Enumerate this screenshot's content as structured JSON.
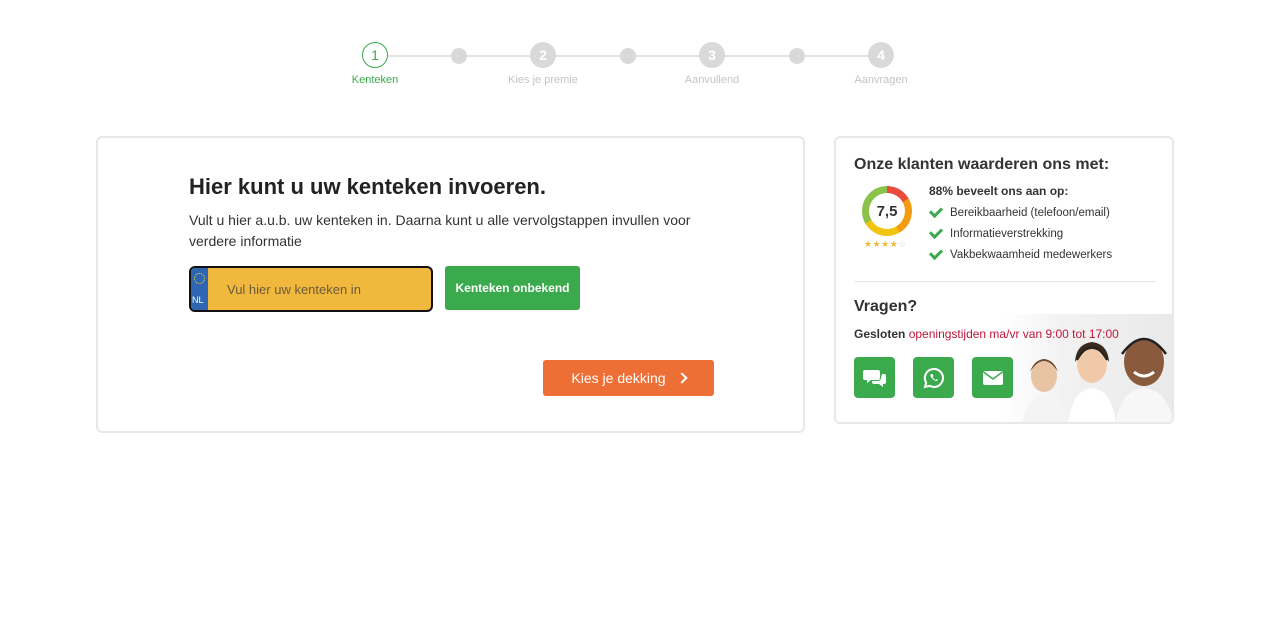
{
  "stepper": {
    "steps": [
      {
        "number": "1",
        "label": "Kenteken",
        "active": true
      },
      {
        "number": "2",
        "label": "Kies je premie",
        "active": false
      },
      {
        "number": "3",
        "label": "Aanvullend",
        "active": false
      },
      {
        "number": "4",
        "label": "Aanvragen",
        "active": false
      }
    ]
  },
  "main": {
    "title": "Hier kunt u uw kenteken invoeren.",
    "description": "Vult u hier a.u.b. uw kenteken in. Daarna kunt u alle vervolgstappen invullen voor verdere informatie",
    "plate": {
      "country_code": "NL",
      "placeholder": "Vul hier uw kenteken in",
      "value": ""
    },
    "unknown_button": "Kenteken onbekend",
    "next_button": "Kies je dekking"
  },
  "sidebar": {
    "title": "Onze klanten waarderen ons met:",
    "score": "7,5",
    "stars_filled": 4,
    "stars_total": 5,
    "recommend": "88% beveelt ons aan op:",
    "checks": [
      "Bereikbaarheid (telefoon/email)",
      "Informatieverstrekking",
      "Vakbekwaamheid medewerkers"
    ],
    "questions_title": "Vragen?",
    "status_closed": "Gesloten",
    "status_hours": "openingstijden ma/vr van 9:00 tot 17:00",
    "contact_buttons": [
      "chat-icon",
      "whatsapp-icon",
      "email-icon"
    ]
  },
  "colors": {
    "green": "#3aaa4d",
    "orange": "#ee6f35",
    "plate_yellow": "#f0b93d",
    "eu_blue": "#2f66b3",
    "hours_red": "#c0153a"
  }
}
